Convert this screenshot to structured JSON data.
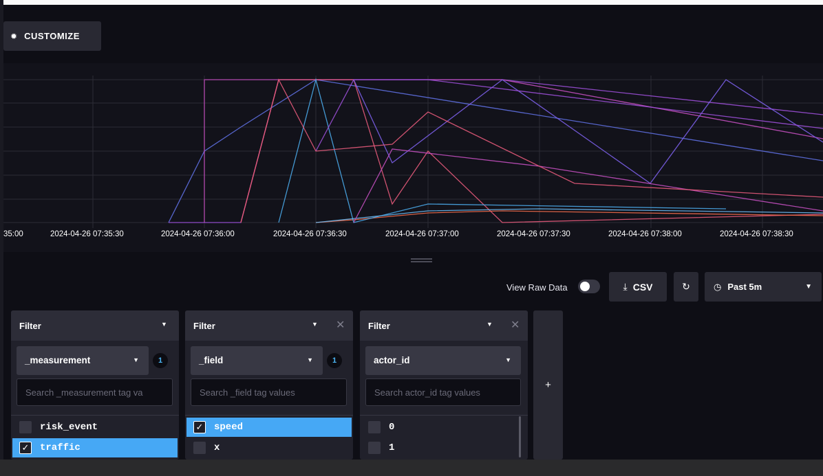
{
  "toolbar": {
    "customize_label": "CUSTOMIZE"
  },
  "graph": {
    "x_tick_labels": [
      "35:00",
      "2024-04-26 07:35:30",
      "2024-04-26 07:36:00",
      "2024-04-26 07:36:30",
      "2024-04-26 07:37:00",
      "2024-04-26 07:37:30",
      "2024-04-26 07:38:00",
      "2024-04-26 07:38:30"
    ],
    "line_colors": [
      "#5e6fe0",
      "#9b4fd6",
      "#c24fbe",
      "#e45a7a",
      "#f06a4a",
      "#4aa8e8",
      "#6ab8f0",
      "#7b5fe8"
    ]
  },
  "controls": {
    "raw_label": "View Raw Data",
    "raw_enabled": false,
    "csv_label": "CSV",
    "time_label": "Past 5m"
  },
  "filters": [
    {
      "title": "Filter",
      "key": "_measurement",
      "count": "1",
      "placeholder": "Search _measurement tag va",
      "items": [
        {
          "label": "risk_event",
          "checked": false
        },
        {
          "label": "traffic",
          "checked": true
        }
      ]
    },
    {
      "title": "Filter",
      "key": "_field",
      "count": "1",
      "placeholder": "Search _field tag values",
      "items": [
        {
          "label": "speed",
          "checked": true
        },
        {
          "label": "x",
          "checked": false
        }
      ]
    },
    {
      "title": "Filter",
      "key": "actor_id",
      "count": "",
      "placeholder": "Search actor_id tag values",
      "items": [
        {
          "label": "0",
          "checked": false
        },
        {
          "label": "1",
          "checked": false
        }
      ]
    }
  ],
  "add_filter_label": "+"
}
